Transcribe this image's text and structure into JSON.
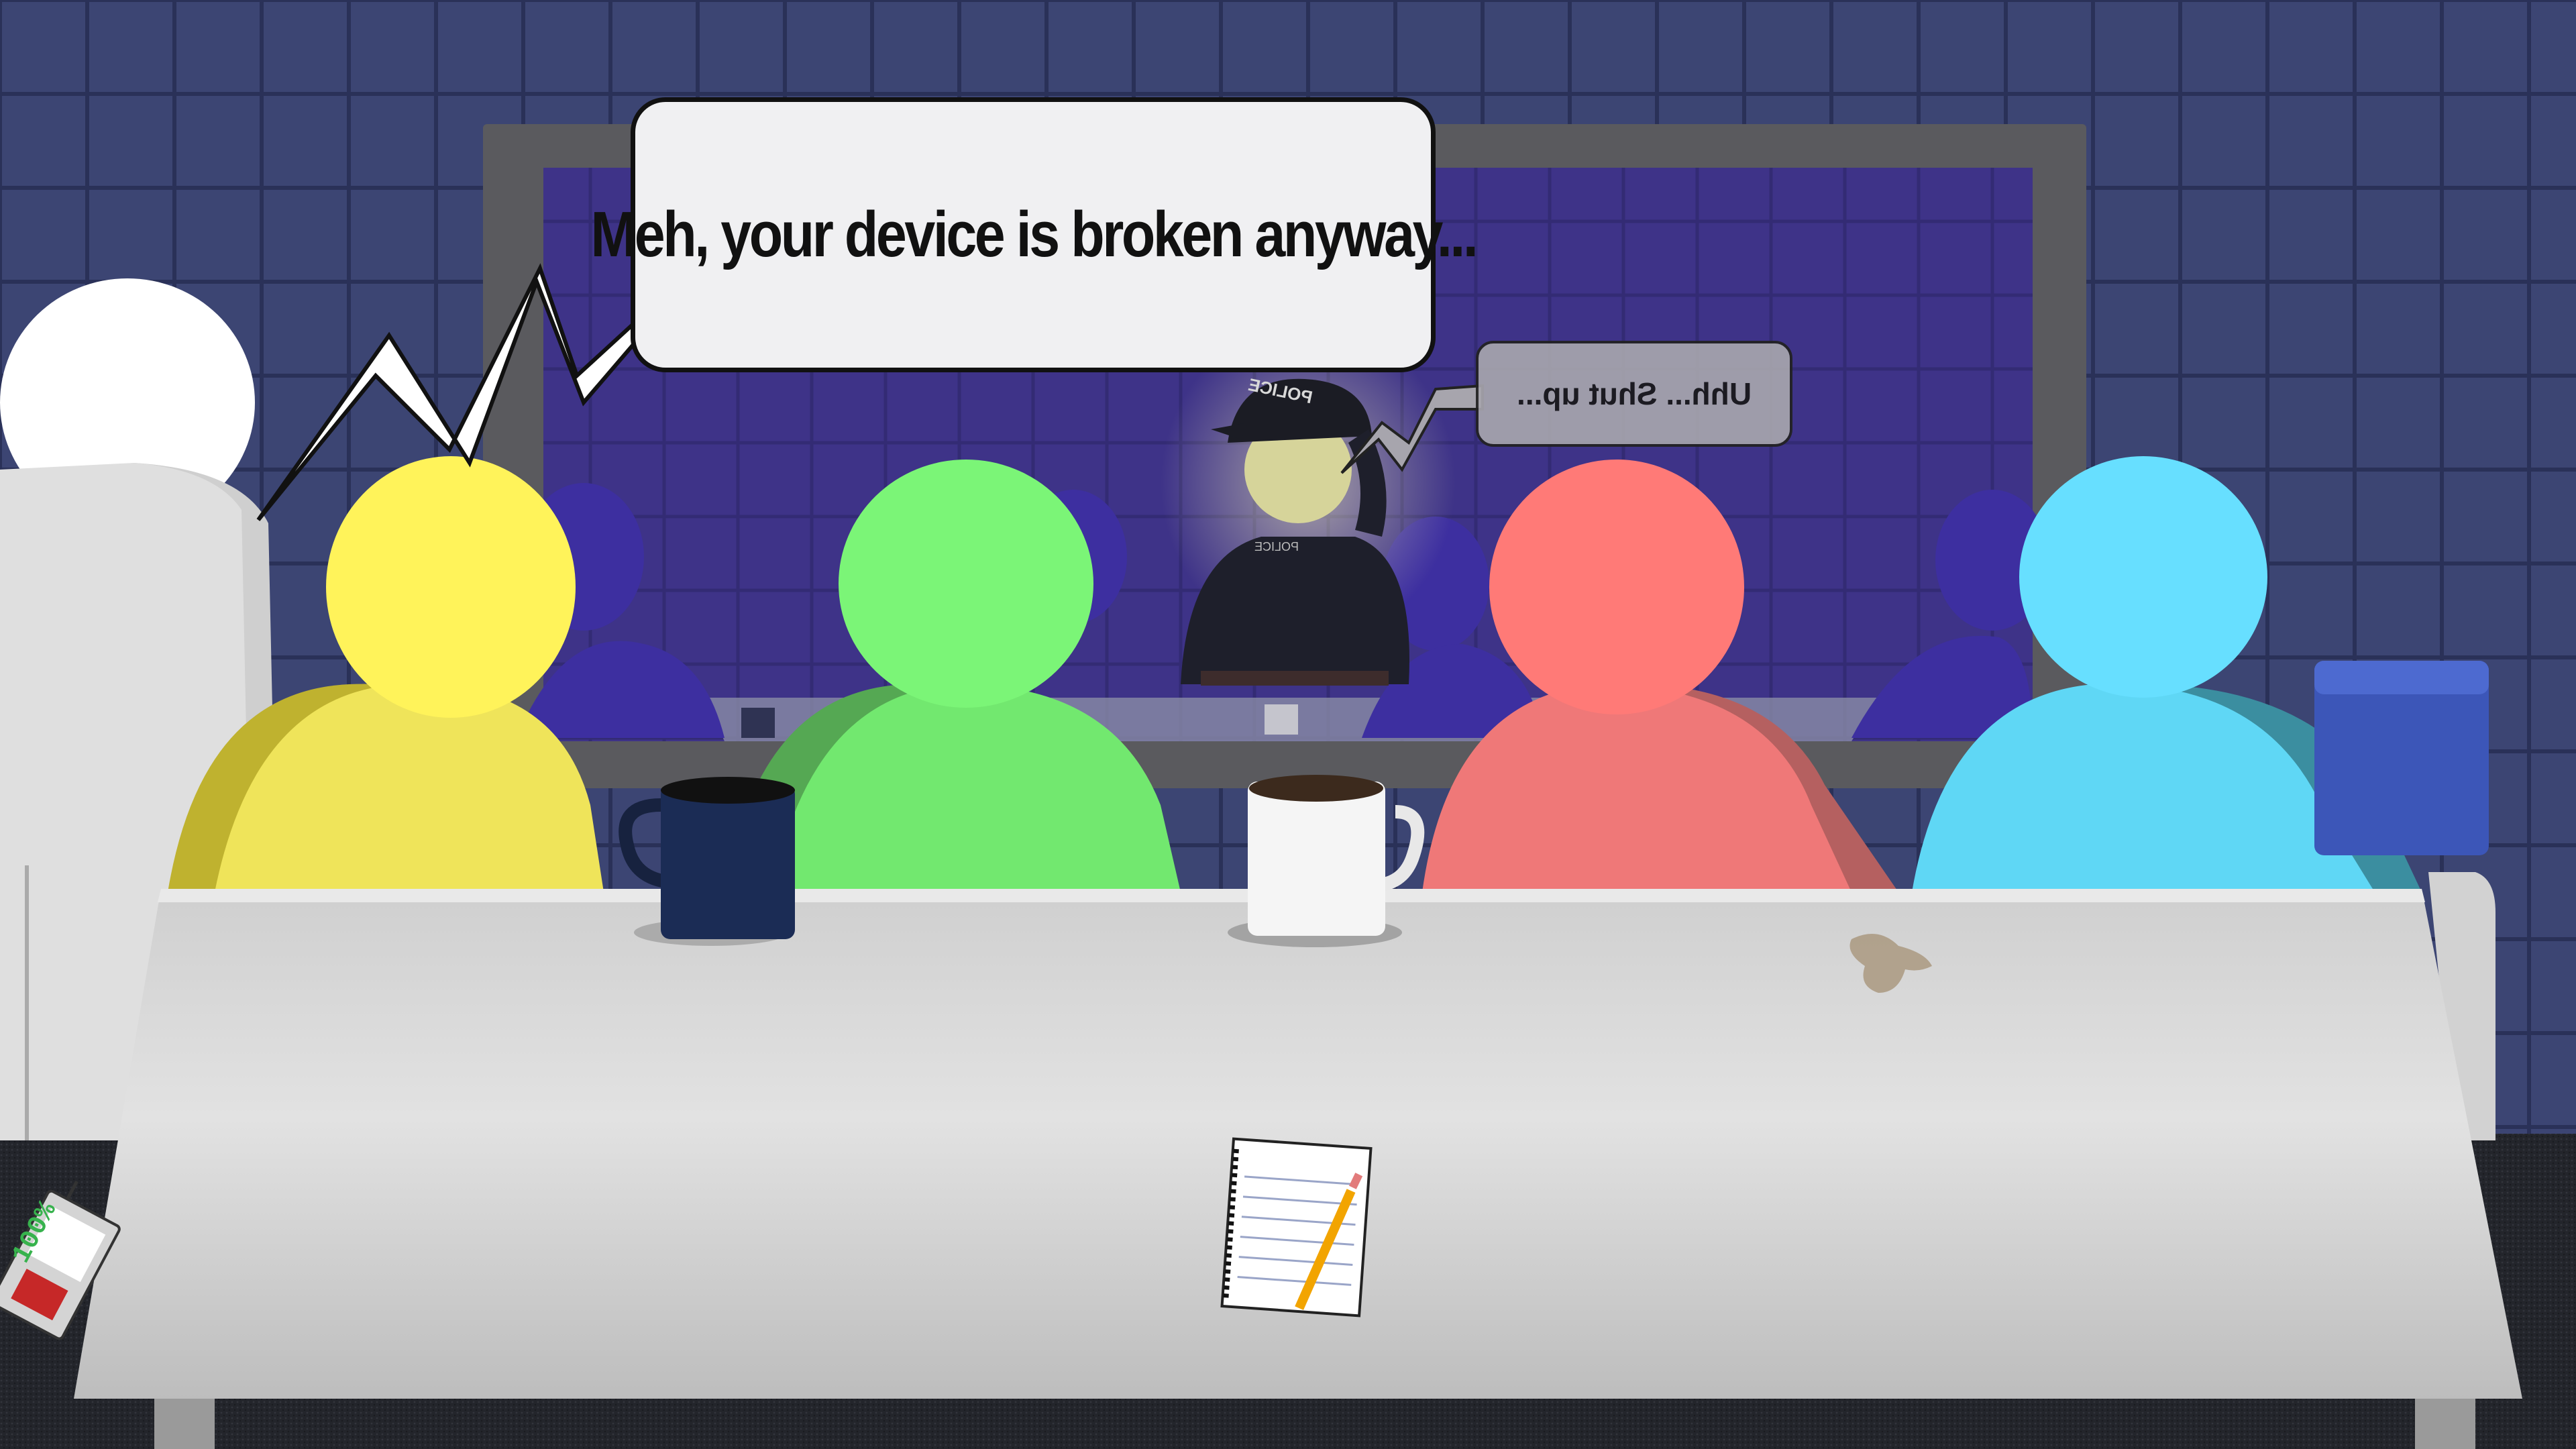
{
  "dialogue": {
    "main_speech": "Meh, your device is broken anyway...",
    "reflection_speech": "Uhh... Shut up..."
  },
  "reflection": {
    "police_cap_text": "POLICE",
    "police_chest_text": "POLICE"
  },
  "device": {
    "readout": "100%"
  },
  "colors": {
    "wall": "#3b4472",
    "window_bg": "#3a2f80",
    "yellow_character": "#fff35a",
    "green_character": "#7bf577",
    "red_character": "#ff7a77",
    "cyan_character": "#67dfff",
    "table": "#d9d9d9"
  }
}
